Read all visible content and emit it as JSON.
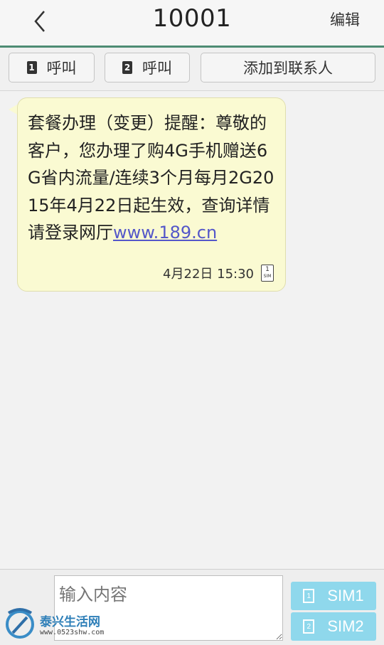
{
  "header": {
    "title": "10001",
    "edit_label": "编辑"
  },
  "actions": {
    "call_sim1": {
      "sim": "1",
      "label": "呼叫"
    },
    "call_sim2": {
      "sim": "2",
      "label": "呼叫"
    },
    "add_contact_label": "添加到联系人"
  },
  "message": {
    "text": "套餐办理（变更）提醒：尊敬的客户，您办理了购4G手机赠送6G省内流量/连续3个月每月2G2015年4月22日起生效，查询详情请登录网厅",
    "link": "www.189.cn",
    "time": "4月22日 15:30",
    "sim_icon_label": "1",
    "sim_icon_text": "SIM"
  },
  "compose": {
    "placeholder": "输入内容",
    "send_sim1": {
      "sim": "1",
      "label": "SIM1"
    },
    "send_sim2": {
      "sim": "2",
      "label": "SIM2"
    }
  },
  "watermark": {
    "name": "泰兴生活网",
    "url": "www.0523shw.com"
  },
  "colors": {
    "accent": "#4e8c73",
    "bubble": "#fafad2",
    "send": "#8fd8ec",
    "link": "#5457c9"
  }
}
